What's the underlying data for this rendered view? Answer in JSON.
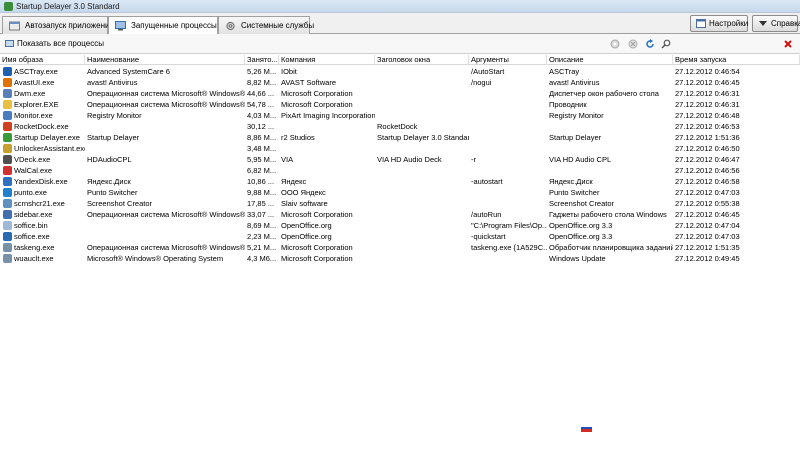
{
  "window": {
    "title": "Startup Delayer 3.0 Standard"
  },
  "tabs": [
    {
      "label": "Автозапуск приложений",
      "icon": "autostart-icon"
    },
    {
      "label": "Запущенные процессы",
      "icon": "processes-icon"
    },
    {
      "label": "Системные службы",
      "icon": "services-icon"
    }
  ],
  "header_buttons": {
    "settings_label": "Настройки",
    "help_label": "Справка"
  },
  "toolbar": {
    "show_all_label": "Показать все процессы"
  },
  "table": {
    "columns": [
      "Имя образа",
      "Наименование",
      "Занято...",
      "Компания",
      "Заголовок окна",
      "Аргументы",
      "Описание",
      "Время запуска"
    ],
    "rows": [
      {
        "icon_color": "#1e5fb0",
        "cells": [
          "ASCTray.exe",
          "Advanced SystemCare 6",
          "5,26 M...",
          "IObit",
          "",
          "/AutoStart",
          "ASCTray",
          "27.12.2012 0:46:54"
        ]
      },
      {
        "icon_color": "#e07000",
        "cells": [
          "AvastUI.exe",
          "avast! Antivirus",
          "8,82 M...",
          "AVAST Software",
          "",
          "/nogui",
          "avast! Antivirus",
          "27.12.2012 0:46:45"
        ]
      },
      {
        "icon_color": "#5a7fb8",
        "cells": [
          "Dwm.exe",
          "Операционная система Microsoft® Windows®",
          "44,66 ...",
          "Microsoft Corporation",
          "",
          "",
          "Диспетчер окон рабочего стола",
          "27.12.2012 0:46:31"
        ]
      },
      {
        "icon_color": "#e8c040",
        "cells": [
          "Explorer.EXE",
          "Операционная система Microsoft® Windows®",
          "54,78 ...",
          "Microsoft Corporation",
          "",
          "",
          "Проводник",
          "27.12.2012 0:46:31"
        ]
      },
      {
        "icon_color": "#4a7ac0",
        "cells": [
          "Monitor.exe",
          "Registry Monitor",
          "4,03 M...",
          "PixArt Imaging Incorporation",
          "",
          "",
          "Registry Monitor",
          "27.12.2012 0:46:48"
        ]
      },
      {
        "icon_color": "#d04020",
        "cells": [
          "RocketDock.exe",
          "",
          "30,12 ...",
          "",
          "RocketDock",
          "",
          "",
          "27.12.2012 0:46:53"
        ]
      },
      {
        "icon_color": "#3a9a3a",
        "cells": [
          "Startup Delayer.exe",
          "Startup Delayer",
          "8,86 M...",
          "r2 Studios",
          "Startup Delayer 3.0 Standard",
          "",
          "Startup Delayer",
          "27.12.2012 1:51:36"
        ]
      },
      {
        "icon_color": "#c8a030",
        "cells": [
          "UnlockerAssistant.exe",
          "",
          "3,48 M...",
          "",
          "",
          "",
          "",
          "27.12.2012 0:46:50"
        ]
      },
      {
        "icon_color": "#505050",
        "cells": [
          "VDeck.exe",
          "HDAudioCPL",
          "5,95 M...",
          "VIA",
          "VIA HD Audio Deck",
          "-r",
          "VIA HD Audio CPL",
          "27.12.2012 0:46:47"
        ]
      },
      {
        "icon_color": "#d03030",
        "cells": [
          "WalCal.exe",
          "",
          "6,82 M...",
          "",
          "",
          "",
          "",
          "27.12.2012 0:46:56"
        ]
      },
      {
        "icon_color": "#3070c0",
        "cells": [
          "YandexDisk.exe",
          "Яндекс.Диск",
          "10,86 ...",
          "Яндекс",
          "",
          "-autostart",
          "Яндекс.Диск",
          "27.12.2012 0:46:58"
        ]
      },
      {
        "icon_color": "#2080d0",
        "cells": [
          "punto.exe",
          "Punto Switcher",
          "9,88 M...",
          "ООО Яндекс",
          "",
          "",
          "Punto Switcher",
          "27.12.2012 0:47:03"
        ]
      },
      {
        "icon_color": "#6090c0",
        "cells": [
          "scrnshcr21.exe",
          "Screenshot Creator",
          "17,85 ...",
          "Slaiv software",
          "",
          "",
          "Screenshot Creator",
          "27.12.2012 0:55:38"
        ]
      },
      {
        "icon_color": "#4070b0",
        "cells": [
          "sidebar.exe",
          "Операционная система Microsoft® Windows®",
          "33,07 ...",
          "Microsoft Corporation",
          "",
          "/autoRun",
          "Гаджеты рабочего стола Windows",
          "27.12.2012 0:46:45"
        ]
      },
      {
        "icon_color": "#a0b8d8",
        "cells": [
          "soffice.bin",
          "",
          "8,69 M...",
          "OpenOffice.org",
          "",
          "\"C:\\Program Files\\Op...",
          "OpenOffice.org 3.3",
          "27.12.2012 0:47:04"
        ]
      },
      {
        "icon_color": "#2a6ab0",
        "cells": [
          "soffice.exe",
          "",
          "2,23 M...",
          "OpenOffice.org",
          "",
          "-quickstart",
          "OpenOffice.org 3.3",
          "27.12.2012 0:47:03"
        ]
      },
      {
        "icon_color": "#7890a8",
        "cells": [
          "taskeng.exe",
          "Операционная система Microsoft® Windows®",
          "5,21 M...",
          "Microsoft Corporation",
          "",
          "taskeng.exe {1A529C...",
          "Обработчик планировщика заданий",
          "27.12.2012 1:51:35"
        ]
      },
      {
        "icon_color": "#7890a8",
        "cells": [
          "wuauclt.exe",
          "Microsoft® Windows® Operating System",
          "4,3 M6...",
          "Microsoft Corporation",
          "",
          "",
          "Windows Update",
          "27.12.2012 0:49:45"
        ]
      }
    ]
  },
  "colors": {
    "accent": "#3a8b3a",
    "flag": [
      "#ffffff",
      "#1f4fbf",
      "#d52b1e"
    ]
  },
  "icons": {
    "refresh": "refresh-icon",
    "search": "find-icon",
    "close": "close-icon",
    "settings": "settings-icon",
    "help": "help-icon"
  }
}
